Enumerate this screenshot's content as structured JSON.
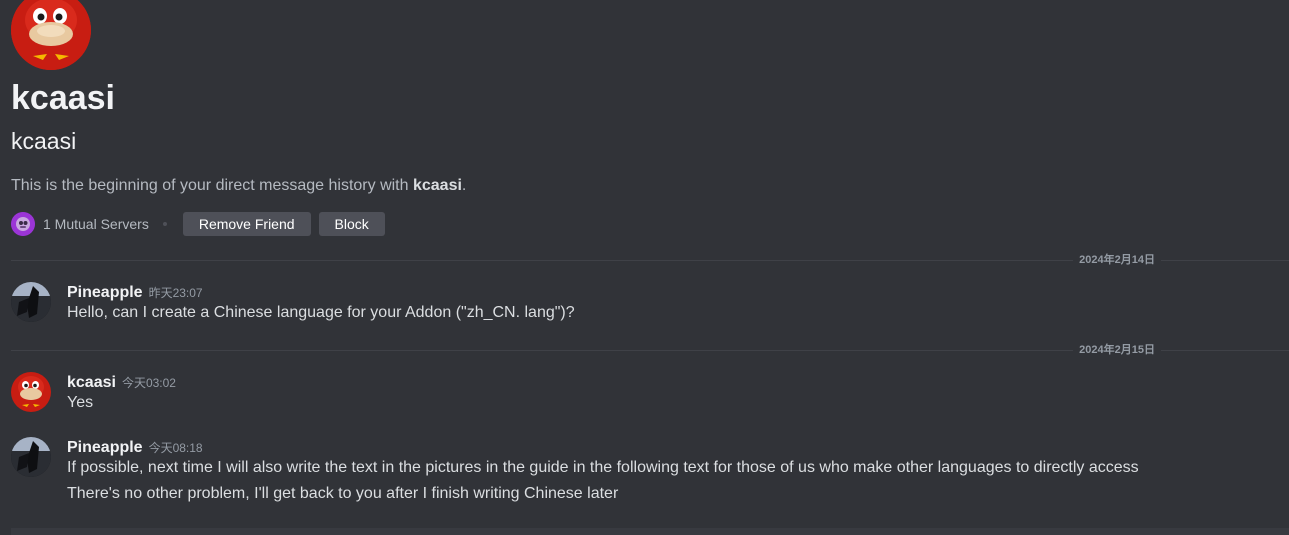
{
  "profile": {
    "display_name": "kcaasi",
    "username": "kcaasi",
    "beginning_prefix": "This is the beginning of your direct message history with ",
    "beginning_name": "kcaasi",
    "beginning_suffix": ".",
    "mutual_servers": "1 Mutual Servers",
    "remove_friend_label": "Remove Friend",
    "block_label": "Block"
  },
  "dividers": [
    {
      "date": "2024年2月14日"
    },
    {
      "date": "2024年2月15日"
    }
  ],
  "messages": [
    {
      "author": "Pineapple",
      "time": "昨天23:07",
      "lines": [
        "Hello, can I create a Chinese language for your Addon (\"zh_CN. lang\")?"
      ]
    },
    {
      "author": "kcaasi",
      "time": "今天03:02",
      "lines": [
        "Yes"
      ]
    },
    {
      "author": "Pineapple",
      "time": "今天08:18",
      "lines": [
        "If possible, next time I will also write the text in the pictures in the guide in the following text for those of us who make other languages to directly access",
        "There's no other problem, I'll get back to you after I finish writing Chinese later"
      ]
    }
  ],
  "colors": {
    "background": "#313338",
    "button": "#4e5058",
    "text": "#dbdee1",
    "muted": "#949ba4"
  },
  "icons": {
    "profile_avatar": "red-knuckles-avatar",
    "mutual_server": "server-icon",
    "pineapple_avatar": "dark-photo-avatar"
  }
}
